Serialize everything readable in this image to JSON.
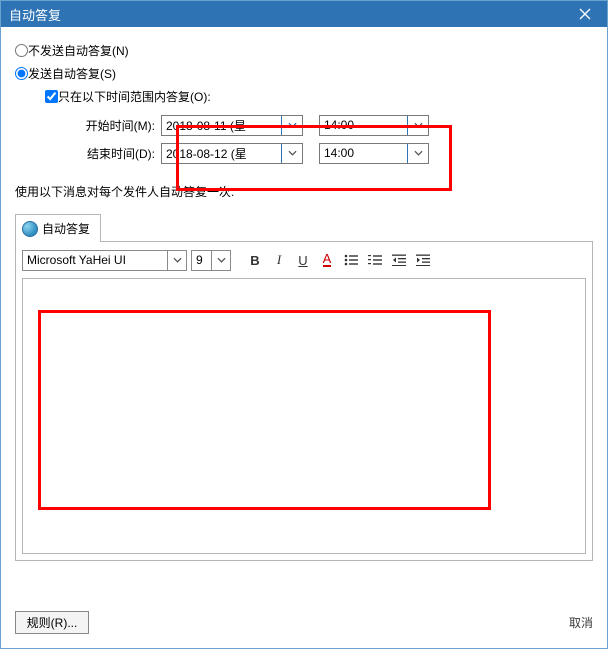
{
  "title": "自动答复",
  "radios": {
    "off_label": "不发送自动答复(N)",
    "on_label": "发送自动答复(S)",
    "selected": "on"
  },
  "check": {
    "range_label": "只在以下时间范围内答复(O):",
    "checked": true
  },
  "times": {
    "start_label": "开始时间(M):",
    "start_date": "2018-08-11 (星",
    "start_time": "14:00",
    "end_label": "结束时间(D):",
    "end_date": "2018-08-12 (星",
    "end_time": "14:00"
  },
  "note": "使用以下消息对每个发件人自动答复一次:",
  "tab_label": "自动答复",
  "toolbar": {
    "font": "Microsoft YaHei UI",
    "size": "9"
  },
  "footer": {
    "rules_label": "规则(R)...",
    "cancel_label": "取消"
  }
}
